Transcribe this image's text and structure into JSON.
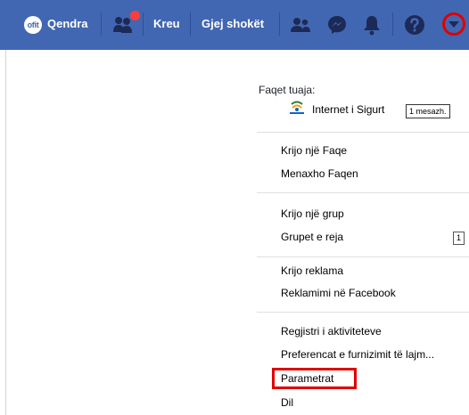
{
  "topbar": {
    "avatar_text": "ofit",
    "profile_label": "Qendra",
    "home_label": "Kreu",
    "find_friends_label": "Gjej shokët"
  },
  "menu": {
    "pages_header": "Faqet tuaja:",
    "page": {
      "name": "Internet i Sigurt",
      "messages_badge": "1 mesazh."
    },
    "create_page": "Krijo një Faqe",
    "manage_page": "Menaxho Faqen",
    "create_group": "Krijo një grup",
    "new_groups": "Grupet e reja",
    "new_groups_count": "1",
    "create_ad": "Krijo reklama",
    "advertising": "Reklamimi në Facebook",
    "activity_log": "Regjistri i aktiviteteve",
    "news_feed_prefs": "Preferencat e furnizimit të lajm...",
    "settings": "Parametrat",
    "logout": "Dil"
  },
  "colors": {
    "brand_blue": "#4267b2",
    "highlight_red": "#e00000"
  }
}
